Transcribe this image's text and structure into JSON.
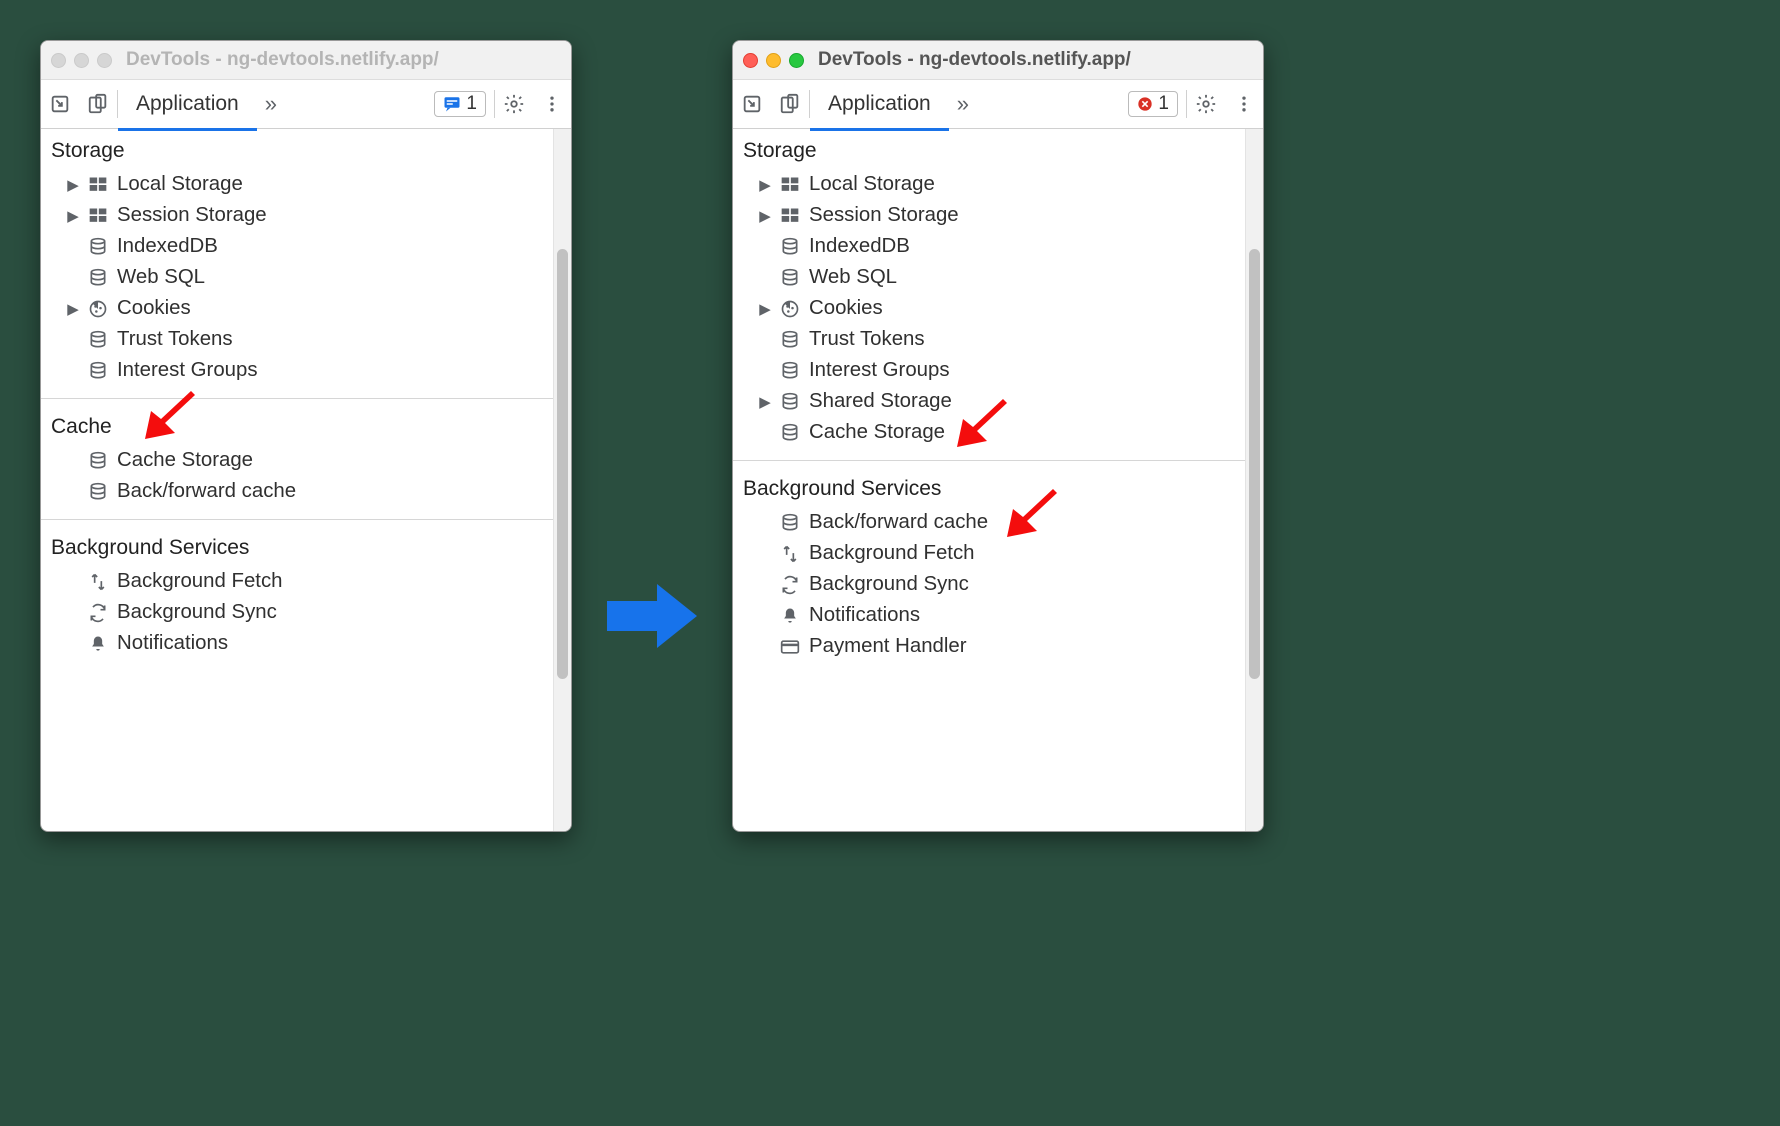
{
  "colors": {
    "accent": "#1a73e8",
    "annotation": "#f40d0d"
  },
  "left": {
    "focused": false,
    "title": "DevTools - ng-devtools.netlify.app/",
    "tab": "Application",
    "badge": {
      "type": "info",
      "count": "1"
    },
    "sections": [
      {
        "title": "Storage",
        "arrow": false,
        "items": [
          {
            "label": "Local Storage",
            "icon": "grid",
            "expandable": true
          },
          {
            "label": "Session Storage",
            "icon": "grid",
            "expandable": true
          },
          {
            "label": "IndexedDB",
            "icon": "db",
            "expandable": false
          },
          {
            "label": "Web SQL",
            "icon": "db",
            "expandable": false
          },
          {
            "label": "Cookies",
            "icon": "cookie",
            "expandable": true
          },
          {
            "label": "Trust Tokens",
            "icon": "db",
            "expandable": false
          },
          {
            "label": "Interest Groups",
            "icon": "db",
            "expandable": false
          }
        ]
      },
      {
        "title": "Cache",
        "arrow": true,
        "items": [
          {
            "label": "Cache Storage",
            "icon": "db",
            "expandable": false
          },
          {
            "label": "Back/forward cache",
            "icon": "db",
            "expandable": false
          }
        ]
      },
      {
        "title": "Background Services",
        "arrow": false,
        "items": [
          {
            "label": "Background Fetch",
            "icon": "fetch",
            "expandable": false
          },
          {
            "label": "Background Sync",
            "icon": "sync",
            "expandable": false
          },
          {
            "label": "Notifications",
            "icon": "bell",
            "expandable": false
          }
        ]
      }
    ]
  },
  "right": {
    "focused": true,
    "title": "DevTools - ng-devtools.netlify.app/",
    "tab": "Application",
    "badge": {
      "type": "error",
      "count": "1"
    },
    "sections": [
      {
        "title": "Storage",
        "arrow": false,
        "items": [
          {
            "label": "Local Storage",
            "icon": "grid",
            "expandable": true
          },
          {
            "label": "Session Storage",
            "icon": "grid",
            "expandable": true
          },
          {
            "label": "IndexedDB",
            "icon": "db",
            "expandable": false
          },
          {
            "label": "Web SQL",
            "icon": "db",
            "expandable": false
          },
          {
            "label": "Cookies",
            "icon": "cookie",
            "expandable": true
          },
          {
            "label": "Trust Tokens",
            "icon": "db",
            "expandable": false
          },
          {
            "label": "Interest Groups",
            "icon": "db",
            "expandable": false
          },
          {
            "label": "Shared Storage",
            "icon": "db",
            "expandable": true
          },
          {
            "label": "Cache Storage",
            "icon": "db",
            "expandable": false,
            "arrow": true
          }
        ]
      },
      {
        "title": "Background Services",
        "arrow": false,
        "items": [
          {
            "label": "Back/forward cache",
            "icon": "db",
            "expandable": false,
            "arrow": true
          },
          {
            "label": "Background Fetch",
            "icon": "fetch",
            "expandable": false
          },
          {
            "label": "Background Sync",
            "icon": "sync",
            "expandable": false
          },
          {
            "label": "Notifications",
            "icon": "bell",
            "expandable": false
          },
          {
            "label": "Payment Handler",
            "icon": "card",
            "expandable": false
          }
        ]
      }
    ]
  }
}
